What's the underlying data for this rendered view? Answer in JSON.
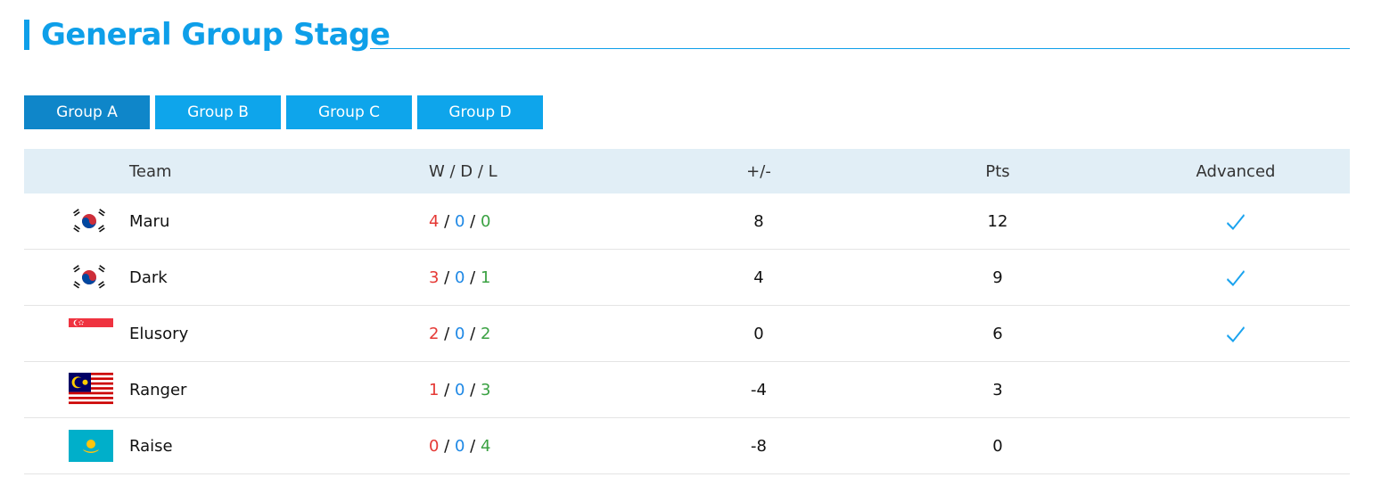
{
  "page": {
    "title": "General Group Stage"
  },
  "tabs": [
    {
      "label": "Group A",
      "active": true
    },
    {
      "label": "Group B",
      "active": false
    },
    {
      "label": "Group C",
      "active": false
    },
    {
      "label": "Group D",
      "active": false
    }
  ],
  "table": {
    "headers": {
      "team": "Team",
      "wdl": "W / D / L",
      "diff": "+/-",
      "pts": "Pts",
      "advanced": "Advanced"
    },
    "rows": [
      {
        "flag": "south-korea-flag-icon",
        "team": "Maru",
        "w": "4",
        "d": "0",
        "l": "0",
        "diff": "8",
        "pts": "12",
        "advanced": true
      },
      {
        "flag": "south-korea-flag-icon",
        "team": "Dark",
        "w": "3",
        "d": "0",
        "l": "1",
        "diff": "4",
        "pts": "9",
        "advanced": true
      },
      {
        "flag": "singapore-flag-icon",
        "team": "Elusory",
        "w": "2",
        "d": "0",
        "l": "2",
        "diff": "0",
        "pts": "6",
        "advanced": true
      },
      {
        "flag": "malaysia-flag-icon",
        "team": "Ranger",
        "w": "1",
        "d": "0",
        "l": "3",
        "diff": "-4",
        "pts": "3",
        "advanced": false
      },
      {
        "flag": "kazakhstan-flag-icon",
        "team": "Raise",
        "w": "0",
        "d": "0",
        "l": "4",
        "diff": "-8",
        "pts": "0",
        "advanced": false
      }
    ]
  },
  "colors": {
    "accent": "#0e9fe9",
    "tab": "#0ea5eb",
    "tab_active": "#0f86c9",
    "header_bg": "#e1eef6",
    "win": "#e53935",
    "draw": "#1e88e5",
    "loss": "#3aa142",
    "check": "#1aa3ef"
  }
}
